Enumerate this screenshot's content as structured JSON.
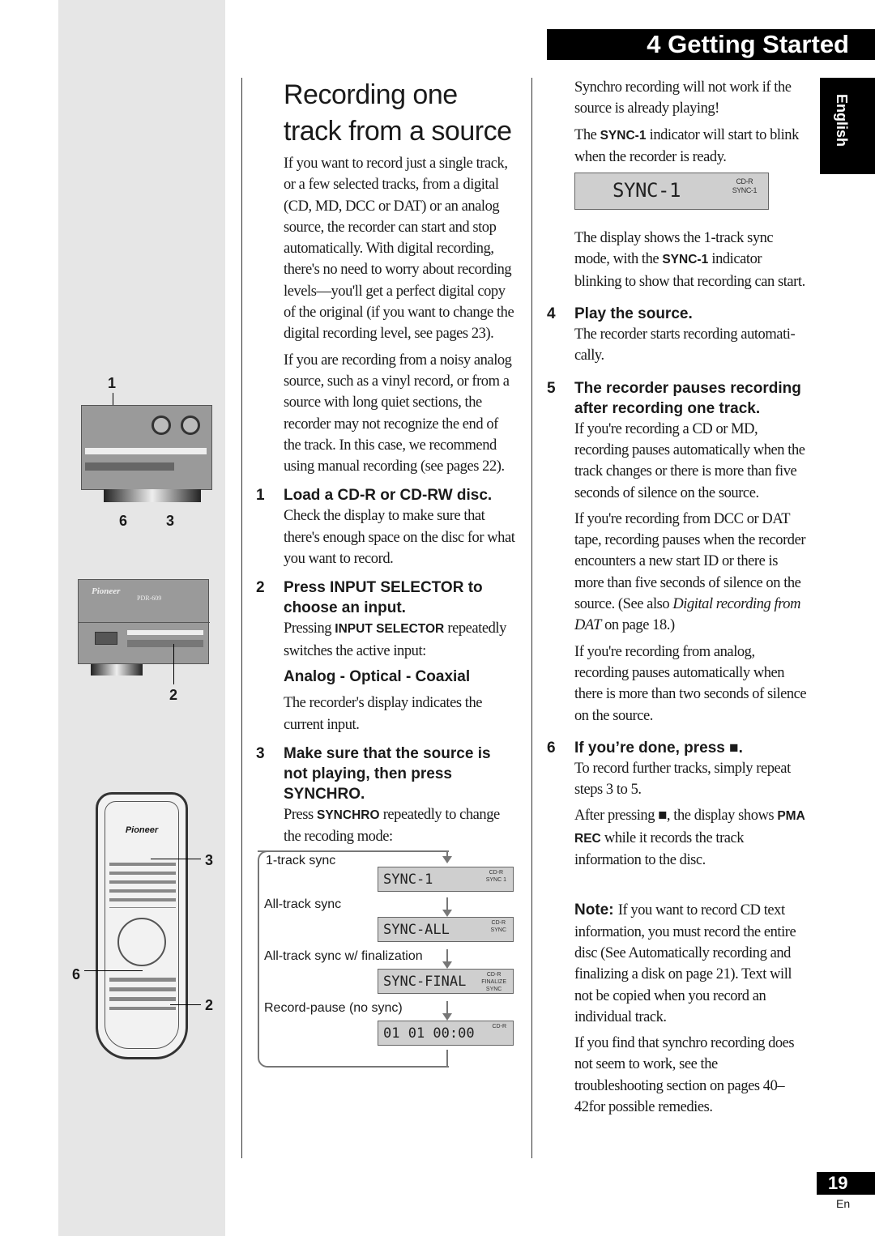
{
  "header": {
    "title": "4 Getting Started",
    "language_tab": "English",
    "page_number": "19",
    "page_lang": "En"
  },
  "illustrations": {
    "recorder_callouts": [
      "1",
      "6",
      "3"
    ],
    "front_panel_callouts": [
      "2"
    ],
    "front_panel_brand": "Pioneer",
    "front_panel_model": "PDR-609",
    "remote_callouts": [
      "3",
      "6",
      "2"
    ],
    "remote_brand": "Pioneer"
  },
  "left_column": {
    "title_line1": "Recording one",
    "title_line2": "track from a source",
    "intro": [
      [
        {
          "t": "If you want to record just a single track, or a few selected tracks, from a digital (CD, MD, DCC or DAT) or an analog source, the recorder can start and stop automatically. With digital recording, there's no need to worry about recording levels—you'll get a perfect digital copy of the original (if you want to change the digital recording level, see pages 23)."
        }
      ],
      [
        {
          "t": "If you are recording from a noisy analog source, such as a vinyl record, or from a source with long quiet sections, the recorder may not recognize the end of the track. In this case, we recommend using manual recording (see pages 22)."
        }
      ]
    ],
    "steps": [
      {
        "num": "1",
        "heading": "Load a CD-R or CD-RW disc.",
        "paras": [
          [
            {
              "t": "Check the display to make sure that there's enough space on the disc for what you want to record."
            }
          ]
        ]
      },
      {
        "num": "2",
        "heading": "Press INPUT SELECTOR to choose an input.",
        "paras": [
          [
            {
              "t": "Pressing "
            },
            {
              "t": "INPUT SELECTOR",
              "b": true
            },
            {
              "t": " repeatedly switches the active input:"
            }
          ]
        ],
        "sub": "Analog - Optical - Coaxial",
        "after": [
          [
            {
              "t": "The recorder's display indicates the current input."
            }
          ]
        ]
      },
      {
        "num": "3",
        "heading": "Make sure that the source is not playing, then press SYNCHRO.",
        "paras": [
          [
            {
              "t": "Press "
            },
            {
              "t": "SYNCHRO",
              "b": true
            },
            {
              "t": " repeatedly to change the recoding mode:"
            }
          ]
        ]
      }
    ],
    "sync_modes": [
      {
        "label": "1-track sync",
        "display": "SYNC-1",
        "indicator": [
          "CD-R",
          "SYNC 1"
        ]
      },
      {
        "label": "All-track sync",
        "display": "SYNC-ALL",
        "indicator": [
          "CD-R",
          "SYNC"
        ]
      },
      {
        "label": "All-track sync w/ finalization",
        "display": "SYNC-FINAL",
        "indicator": [
          "CD-R",
          "FINALIZE",
          "SYNC"
        ]
      },
      {
        "label": "Record-pause (no sync)",
        "display": "01 01 00:00",
        "indicator": [
          "CD-R"
        ]
      }
    ]
  },
  "right_column": {
    "top": [
      [
        {
          "t": "Synchro recording will not work if the source is already playing!"
        }
      ],
      [
        {
          "t": "The "
        },
        {
          "t": "SYNC-1",
          "b": true
        },
        {
          "t": " indicator will start to blink when the recorder is ready."
        }
      ]
    ],
    "display": {
      "text": "SYNC-1",
      "indicator": [
        "CD-R",
        "SYNC-1"
      ]
    },
    "after_display": [
      [
        {
          "t": "The display shows the 1-track sync mode, with the "
        },
        {
          "t": "SYNC-1",
          "b": true
        },
        {
          "t": " indicator blinking to show that recording can start."
        }
      ]
    ],
    "steps": [
      {
        "num": "4",
        "heading": "Play the source.",
        "paras": [
          [
            {
              "t": "The recorder starts recording automati-cally."
            }
          ]
        ]
      },
      {
        "num": "5",
        "heading": "The recorder pauses recording after recording one track.",
        "paras": [
          [
            {
              "t": "If you're recording a CD or MD, recording pauses automatically when the track changes or there is more than five seconds of silence on the source."
            }
          ],
          [
            {
              "t": "If you're recording from DCC or DAT tape, recording pauses when the recorder encounters a new start ID or there is more than five seconds of silence on the source. (See also "
            },
            {
              "t": "Digital recording from DAT",
              "i": true
            },
            {
              "t": " on page 18.)"
            }
          ],
          [
            {
              "t": "If you're recording from analog, recording pauses automatically when there is more than two seconds of silence on the source."
            }
          ]
        ]
      },
      {
        "num": "6",
        "heading": "If you’re done, press ■.",
        "paras": [
          [
            {
              "t": "To record further tracks, simply repeat steps 3 to 5."
            }
          ],
          [
            {
              "t": "After pressing ■, the display shows "
            },
            {
              "t": "PMA REC",
              "b": true
            },
            {
              "t": " while it records the track information to the disc."
            }
          ]
        ]
      }
    ],
    "note": [
      {
        "t": "Note: ",
        "b": true,
        "big": true
      },
      {
        "t": "If you want to record CD text information, you must record the entire disc (See Automatically recording and finalizing a disk on page 21). Text will not be copied when you record an individual track."
      }
    ],
    "final": [
      [
        {
          "t": "If you find that synchro recording does not seem to work, see the troubleshooting section on pages 40–42for possible remedies."
        }
      ]
    ]
  }
}
